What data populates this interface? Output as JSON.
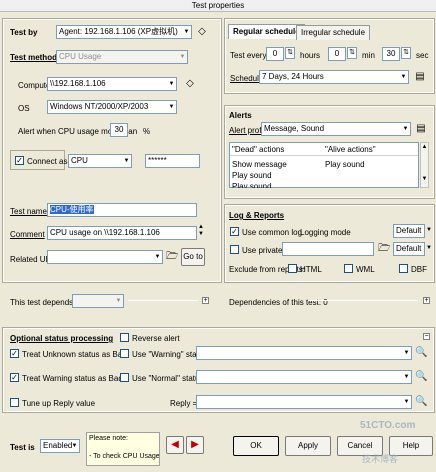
{
  "window": {
    "title": "Test properties"
  },
  "test_by": {
    "label": "Test by",
    "agent": "Agent: 192.168.1.106 (XP虚拟机)"
  },
  "test_method": {
    "label": "Test method",
    "value": "CPU Usage"
  },
  "computer": {
    "label": "Computer",
    "value": "\\\\192.168.1.106"
  },
  "os": {
    "label": "OS",
    "value": "Windows NT/2000/XP/2003"
  },
  "alert_cpu": {
    "label": "Alert when CPU usage more than",
    "value": "30",
    "unit": "%"
  },
  "connect_as": {
    "label": "Connect as :",
    "user": "CPU",
    "password": "******",
    "checked": true
  },
  "test_name": {
    "label": "Test name",
    "value": "CPU-使用率"
  },
  "comment": {
    "label": "Comment",
    "value": "CPU usage on \\\\192.168.1.106"
  },
  "related_url": {
    "label": "Related URL",
    "goto": "Go to"
  },
  "depends_on": {
    "label": "This test depends on"
  },
  "dependencies": {
    "label": "Dependencies of this test: 0"
  },
  "schedule": {
    "tab_regular": "Regular schedule",
    "tab_irregular": "Irregular schedule",
    "test_every_label": "Test every",
    "hours_value": "0",
    "hours_label": "hours",
    "min_value": "0",
    "min_label": "min",
    "sec_value": "30",
    "sec_label": "sec",
    "schedule_label": "Schedule",
    "schedule_value": "7 Days, 24 Hours"
  },
  "alerts": {
    "title": "Alerts",
    "profile_label": "Alert profile",
    "profile_value": "Message, Sound",
    "col_dead": "\"Dead\" actions",
    "col_alive": "\"Alive actions\"",
    "rows": [
      {
        "dead": "Show message",
        "alive": "Play sound"
      },
      {
        "dead": "Play sound",
        "alive": ""
      },
      {
        "dead": "Play sound",
        "alive": ""
      }
    ]
  },
  "log": {
    "title": "Log & Reports",
    "common_label": "Use common log",
    "logging_mode_label": "Logging mode",
    "common_mode": "Default",
    "private_label": "Use private log",
    "private_mode": "Default",
    "exclude_label": "Exclude from reports:",
    "html": "HTML",
    "wml": "WML",
    "dbf": "DBF"
  },
  "optional": {
    "title": "Optional status processing",
    "reverse_alert": "Reverse alert",
    "unknown_bad": "Treat Unknown status as Bad",
    "warning_bad": "Treat Warning status as Bad",
    "use_warning_if": "Use \"Warning\" status if",
    "use_normal_if": "Use \"Normal\" status if",
    "tune_up": "Tune up Reply value",
    "reply_label": "Reply ="
  },
  "footer": {
    "test_is_label": "Test is",
    "test_is_value": "Enabled",
    "note_line1": "Please note:",
    "note_line2": "- To check CPU Usage on a",
    "ok": "OK",
    "apply": "Apply",
    "cancel": "Cancel",
    "help": "Help"
  },
  "watermark": {
    "site": "51CTO.com",
    "sub": "技术博客"
  }
}
